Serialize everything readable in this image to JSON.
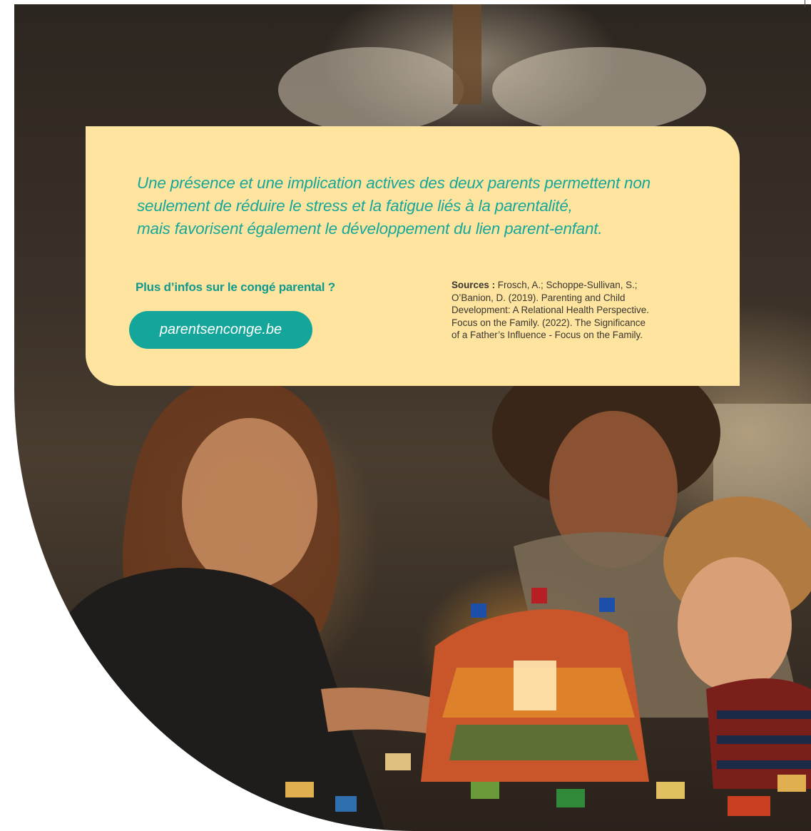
{
  "quote": {
    "lines": [
      "Une présence et une implication actives des deux parents permettent non",
      "seulement de réduire le stress et la fatigue liés à la parentalité,",
      "mais favorisent également le développement du lien parent-enfant."
    ]
  },
  "more_info": {
    "label": "Plus d’infos sur le congé parental ?",
    "link_text": "parentsenconge.be"
  },
  "sources": {
    "heading": "Sources :",
    "lines": [
      "Frosch, A.; Schoppe-Sullivan, S.;",
      "O’Banion, D. (2019). Parenting and Child",
      "Development: A Relational Health Perspective.",
      "Focus on the Family. (2022). The Significance",
      "of a Father’s Influence - Focus on the Family."
    ]
  },
  "colors": {
    "card_background": "#fee49e",
    "accent_teal": "#16a79a",
    "button_teal": "#14a69a"
  }
}
